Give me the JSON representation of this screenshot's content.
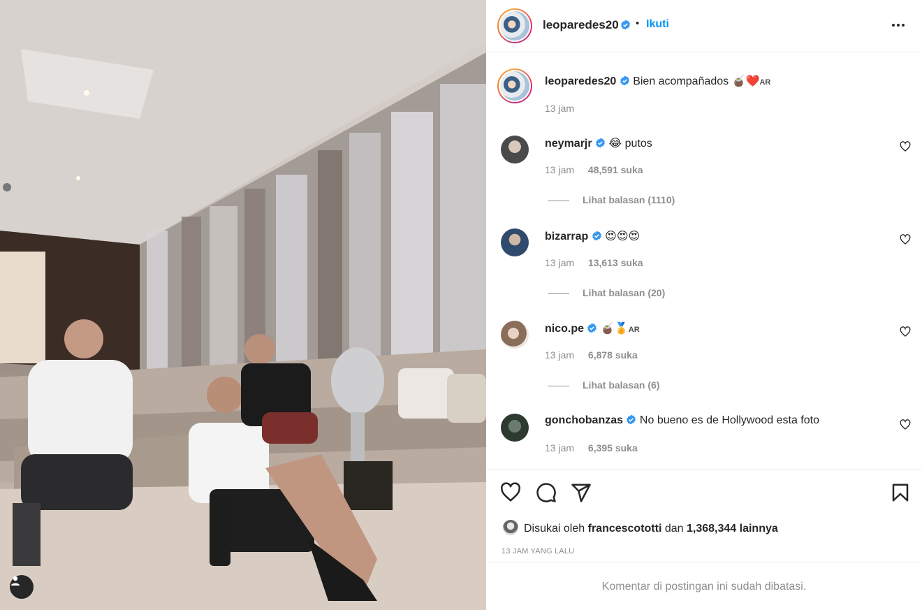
{
  "post": {
    "author": "leoparedes20",
    "follow_label": "Ikuti",
    "separator": "•",
    "more_icon": "more-horizontal-icon"
  },
  "caption": {
    "username": "leoparedes20",
    "text": "Bien acompañados",
    "emojis": "🧉❤️",
    "flag": "AR",
    "time": "13 jam"
  },
  "comments": [
    {
      "username": "neymarjr",
      "text": "😂 putos",
      "time": "13 jam",
      "likes": "48,591 suka",
      "replies": "Lihat balasan (1110)",
      "avatar_color": "#4a4a4a"
    },
    {
      "username": "bizarrap",
      "text": "😍😍😍",
      "time": "13 jam",
      "likes": "13,613 suka",
      "replies": "Lihat balasan (20)",
      "avatar_color": "#2f4a6d"
    },
    {
      "username": "nico.pe",
      "text": "🧉🏅",
      "flag": "AR",
      "time": "13 jam",
      "likes": "6,878 suka",
      "replies": "Lihat balasan (6)",
      "avatar_color": "#8a6d5a"
    },
    {
      "username": "gonchobanzas",
      "text": "No bueno es de Hollywood esta foto",
      "time": "13 jam",
      "likes": "6,395 suka",
      "replies": "",
      "avatar_color": "#2c3a30"
    }
  ],
  "actions": {
    "like_icon": "heart-icon",
    "comment_icon": "comment-icon",
    "share_icon": "send-icon",
    "save_icon": "bookmark-icon"
  },
  "likes": {
    "prefix": "Disukai oleh",
    "user": "francescototti",
    "middle": "dan",
    "count": "1,368,344 lainnya"
  },
  "post_time": "13 JAM YANG LALU",
  "comments_limited": "Komentar di postingan ini sudah dibatasi.",
  "colors": {
    "link_blue": "#0095f6",
    "muted": "#8e8e8e",
    "verified_blue": "#3897f0"
  }
}
